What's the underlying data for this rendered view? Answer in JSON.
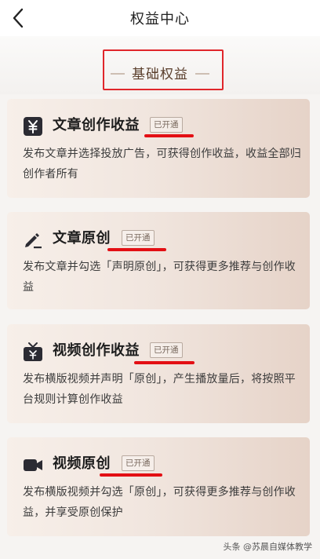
{
  "nav": {
    "title": "权益中心",
    "back_icon": "chevron-left-icon"
  },
  "section": {
    "title": "基础权益"
  },
  "cards": [
    {
      "title": "文章创作收益",
      "badge": "已开通",
      "desc": "发布文章并选择投放广告，可获得创作收益，收益全部归创作者所有",
      "icon": "yuan-icon"
    },
    {
      "title": "文章原创",
      "badge": "已开通",
      "desc": "发布文章并勾选「声明原创」，可获得更多推荐与创作收益",
      "icon": "pen-icon"
    },
    {
      "title": "视频创作收益",
      "badge": "已开通",
      "desc": "发布横版视频并声明「原创」，产生播放量后，将按照平台规则计算创作收益",
      "icon": "tv-icon"
    },
    {
      "title": "视频原创",
      "badge": "已开通",
      "desc": "发布横版视频并勾选「原创」，可获得更多推荐与创作收益，并享受原创保护",
      "icon": "video-camera-icon"
    }
  ],
  "watermark": "头条 @苏晨自媒体教学",
  "colors": {
    "annotation_red": "#e30f14",
    "card_gradient_end": "#e6d3c8",
    "title_brown": "#5a3f2c"
  }
}
